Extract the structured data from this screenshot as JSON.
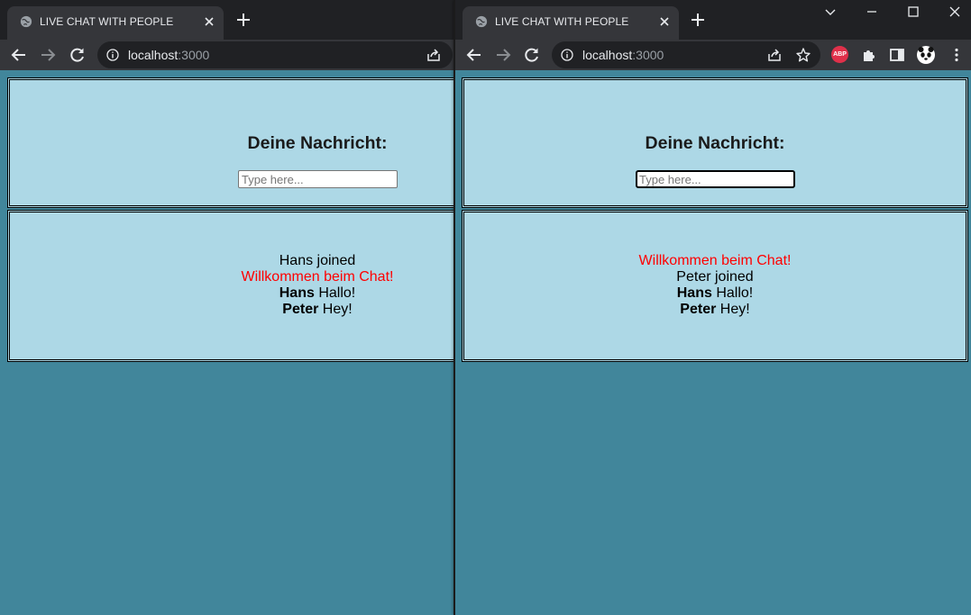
{
  "tab": {
    "title": "LIVE CHAT WITH PEOPLE"
  },
  "address": {
    "host": "localhost",
    "port": ":3000"
  },
  "form": {
    "heading": "Deine Nachricht:",
    "placeholder": "Type here..."
  },
  "extensions": {
    "abp_label": "ABP"
  },
  "colors": {
    "page_bg": "#41869b",
    "panel_bg": "#add8e6",
    "system_text": "#ff0000"
  },
  "left_window": {
    "messages": [
      {
        "user": "",
        "text": "Hans joined",
        "style": "normal"
      },
      {
        "user": "",
        "text": "Willkommen beim Chat!",
        "style": "red"
      },
      {
        "user": "Hans",
        "text": "Hallo!",
        "style": "normal"
      },
      {
        "user": "Peter",
        "text": "Hey!",
        "style": "normal"
      }
    ]
  },
  "right_window": {
    "messages": [
      {
        "user": "",
        "text": "Willkommen beim Chat!",
        "style": "red"
      },
      {
        "user": "",
        "text": "Peter joined",
        "style": "normal"
      },
      {
        "user": "Hans",
        "text": "Hallo!",
        "style": "normal"
      },
      {
        "user": "Peter",
        "text": "Hey!",
        "style": "normal"
      }
    ]
  }
}
